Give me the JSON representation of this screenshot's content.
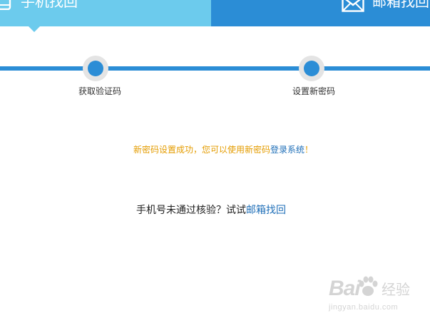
{
  "tabs": {
    "phone": {
      "label": "手机找回",
      "icon": "phone-icon",
      "color": "#6ccbed",
      "active": true
    },
    "email": {
      "label": "邮箱找回",
      "icon": "mail-icon",
      "color": "#2b8dd6",
      "active": false
    }
  },
  "steps": [
    {
      "label": "获取验证码"
    },
    {
      "label": "设置新密码"
    }
  ],
  "success": {
    "message": "新密码设置成功，您可以使用新密码",
    "link": "登录系统",
    "suffix": "！"
  },
  "alternative": {
    "prompt": "手机号未通过核验？试试",
    "link": "邮箱找回"
  },
  "watermark": {
    "brand": "Bai",
    "brand_cn": "经验",
    "url": "jingyan.baidu.com"
  },
  "colors": {
    "accent": "#2b8dd6",
    "active_tab": "#6ccbed",
    "success_text": "#e49c00",
    "link": "#1f6fb8"
  }
}
